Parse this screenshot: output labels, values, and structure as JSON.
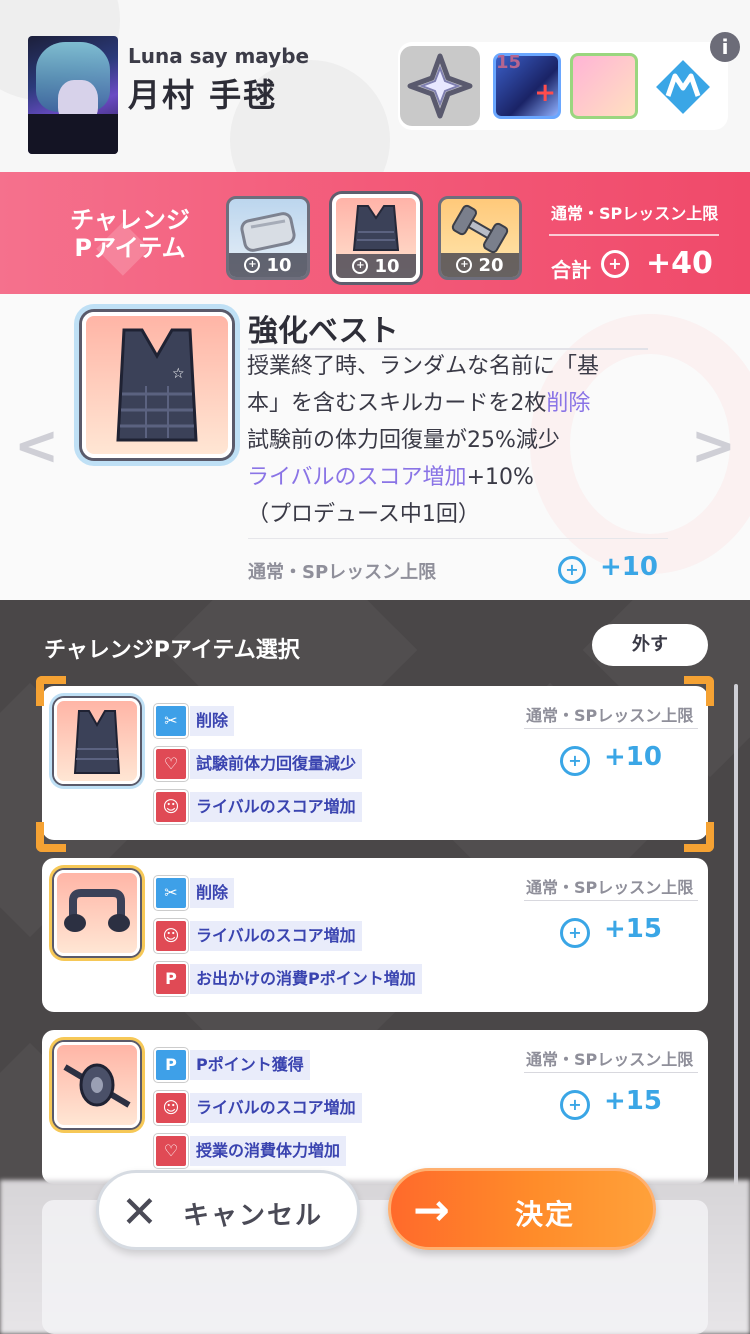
{
  "header": {
    "subtitle": "Luna say maybe",
    "name": "月村 手毬",
    "slot_level": "15",
    "info_icon": "info-icon"
  },
  "challenge": {
    "title_line1": "チャレンジ",
    "title_line2": "Pアイテム",
    "items": [
      {
        "icon": "wristband-icon",
        "cost": "10"
      },
      {
        "icon": "vest-icon",
        "cost": "10"
      },
      {
        "icon": "dumbbell-icon",
        "cost": "20"
      }
    ],
    "limit_label": "通常・SPレッスン上限",
    "total_label": "合計",
    "total_value": "+40"
  },
  "detail": {
    "title": "強化ベスト",
    "desc_l1": "授業終了時、ランダムな名前に「基",
    "desc_l2a": "本」を含むスキルカードを2枚",
    "desc_l2b": "削除",
    "desc_l3": "試験前の体力回復量が25%減少",
    "desc_l4a": "ライバルのスコア増加",
    "desc_l4b": "+10%",
    "desc_l5": "（プロデュース中1回）",
    "limit_label": "通常・SPレッスン上限",
    "value": "+10",
    "arrow_left": "<",
    "arrow_right": ">"
  },
  "panel": {
    "title": "チャレンジPアイテム選択",
    "remove_button": "外す",
    "cards": [
      {
        "icon": "vest-icon",
        "effects": [
          {
            "icon": "delete-card-icon",
            "color": "blue",
            "text": "削除"
          },
          {
            "icon": "heart-icon",
            "color": "red",
            "text": "試験前体力回復量減少"
          },
          {
            "icon": "rival-icon",
            "color": "red",
            "text": "ライバルのスコア増加"
          }
        ],
        "limit_label": "通常・SPレッスン上限",
        "value": "+10"
      },
      {
        "icon": "pushup-bar-icon",
        "effects": [
          {
            "icon": "delete-card-icon",
            "color": "blue",
            "text": "削除"
          },
          {
            "icon": "rival-icon",
            "color": "red",
            "text": "ライバルのスコア増加"
          },
          {
            "icon": "p-point-icon",
            "color": "red",
            "text": "お出かけの消費Pポイント増加"
          }
        ],
        "limit_label": "通常・SPレッスン上限",
        "value": "+15"
      },
      {
        "icon": "ab-roller-icon",
        "effects": [
          {
            "icon": "p-point-icon",
            "color": "blue",
            "text": "Pポイント獲得"
          },
          {
            "icon": "rival-icon",
            "color": "red",
            "text": "ライバルのスコア増加"
          },
          {
            "icon": "heart-icon",
            "color": "red",
            "text": "授業の消費体力増加"
          }
        ],
        "limit_label": "通常・SPレッスン上限",
        "value": "+15"
      }
    ]
  },
  "buttons": {
    "cancel": "キャンセル",
    "confirm": "決定"
  },
  "colors": {
    "accent_pink": "#f35a79",
    "accent_blue": "#3aa6e6",
    "accent_orange": "#ff8c2a",
    "highlight_purple": "#8a74e6"
  }
}
